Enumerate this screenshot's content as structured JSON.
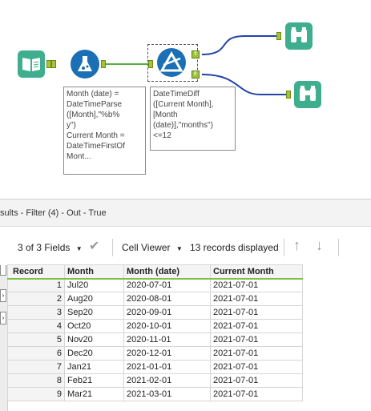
{
  "canvas": {
    "annotation_formula": "Month (date) =\nDateTimeParse\n([Month],\"%b%\ny\")\nCurrent Month =\nDateTimeFirstOf\nMont...",
    "annotation_filter": "DateTimeDiff\n([Current Month],\n[Month\n(date)],\"months\")\n<=12",
    "filter_true_anchor": "T",
    "filter_false_anchor": "F"
  },
  "results": {
    "title": "sults - Filter (4) - Out - True",
    "fields_label": "3 of 3 Fields",
    "cell_viewer_label": "Cell Viewer",
    "records_displayed": "13 records displayed"
  },
  "table": {
    "columns": [
      "Record",
      "Month",
      "Month (date)",
      "Current Month"
    ],
    "rows": [
      [
        "1",
        "Jul20",
        "2020-07-01",
        "2021-07-01"
      ],
      [
        "2",
        "Aug20",
        "2020-08-01",
        "2021-07-01"
      ],
      [
        "3",
        "Sep20",
        "2020-09-01",
        "2021-07-01"
      ],
      [
        "4",
        "Oct20",
        "2020-10-01",
        "2021-07-01"
      ],
      [
        "5",
        "Nov20",
        "2020-11-01",
        "2021-07-01"
      ],
      [
        "6",
        "Dec20",
        "2020-12-01",
        "2021-07-01"
      ],
      [
        "7",
        "Jan21",
        "2021-01-01",
        "2021-07-01"
      ],
      [
        "8",
        "Feb21",
        "2021-02-01",
        "2021-07-01"
      ],
      [
        "9",
        "Mar21",
        "2021-03-01",
        "2021-07-01"
      ]
    ]
  },
  "colors": {
    "input_tool": "#3fae8f",
    "formula_tool": "#1a6fb5",
    "filter_tool": "#1a6fb5",
    "browse_tool": "#3fae8f",
    "connection_green": "#55b044",
    "connection_blue": "#2244aa",
    "header_underline": "#7ac143"
  }
}
